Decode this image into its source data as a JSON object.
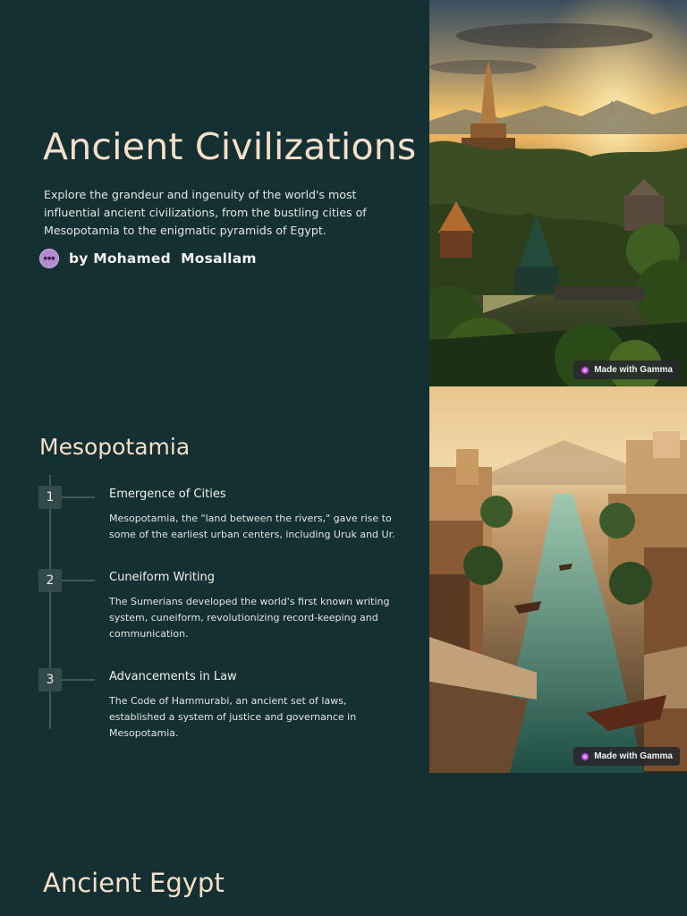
{
  "hero": {
    "title": "Ancient Civilizations",
    "description": "Explore the grandeur and ingenuity of the world's most influential ancient civilizations, from the bustling cities of Mesopotamia to the enigmatic pyramids of Egypt.",
    "author": "by Mohamed  Mosallam",
    "image_badge": "Made with Gamma"
  },
  "mesopotamia": {
    "title": "Mesopotamia",
    "items": [
      {
        "number": "1",
        "title": "Emergence of Cities",
        "body": "Mesopotamia, the \"land between the rivers,\" gave rise to some of the earliest urban centers, including Uruk and Ur."
      },
      {
        "number": "2",
        "title": "Cuneiform Writing",
        "body": "The Sumerians developed the world's first known writing system, cuneiform, revolutionizing record-keeping and communication."
      },
      {
        "number": "3",
        "title": "Advancements in Law",
        "body": "The Code of Hammurabi, an ancient set of laws, established a system of justice and governance in Mesopotamia."
      }
    ],
    "image_badge": "Made with Gamma"
  },
  "egypt": {
    "title": "Ancient Egypt"
  },
  "colors": {
    "background": "#143033",
    "heading": "#f6dfc8",
    "timeline": "#3f5a5b",
    "number_box": "#34494a"
  }
}
